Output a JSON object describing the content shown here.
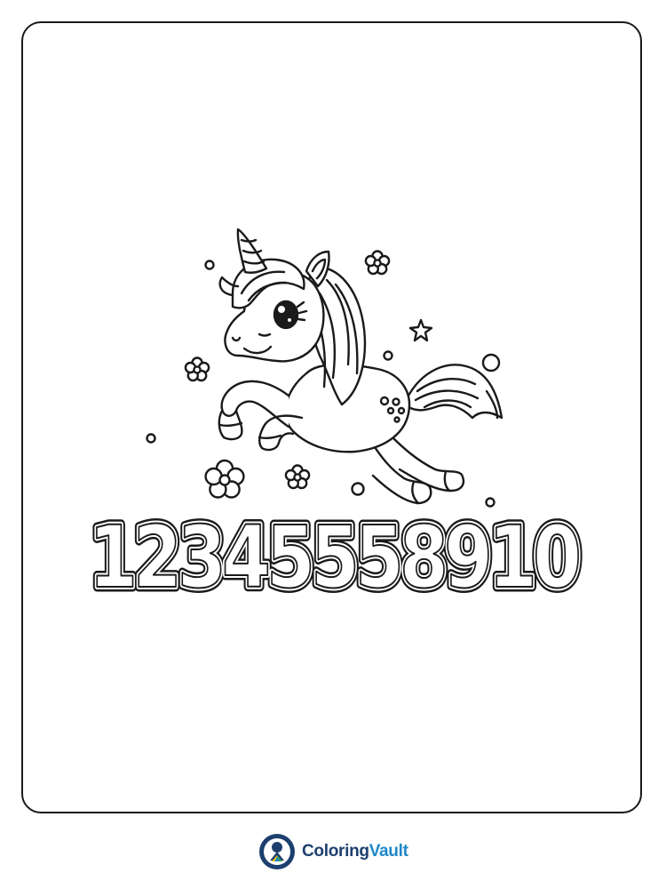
{
  "coloring_page": {
    "numbers_text": "12345558910"
  },
  "brand": {
    "name_part1": "Coloring",
    "name_part2": "Vault",
    "primary_color": "#1d3f6e",
    "accent_color": "#1e88c9",
    "logo_icon": "location-pin-crayon-icon"
  },
  "colors": {
    "line_art": "#1a1a1a",
    "background": "#ffffff"
  }
}
